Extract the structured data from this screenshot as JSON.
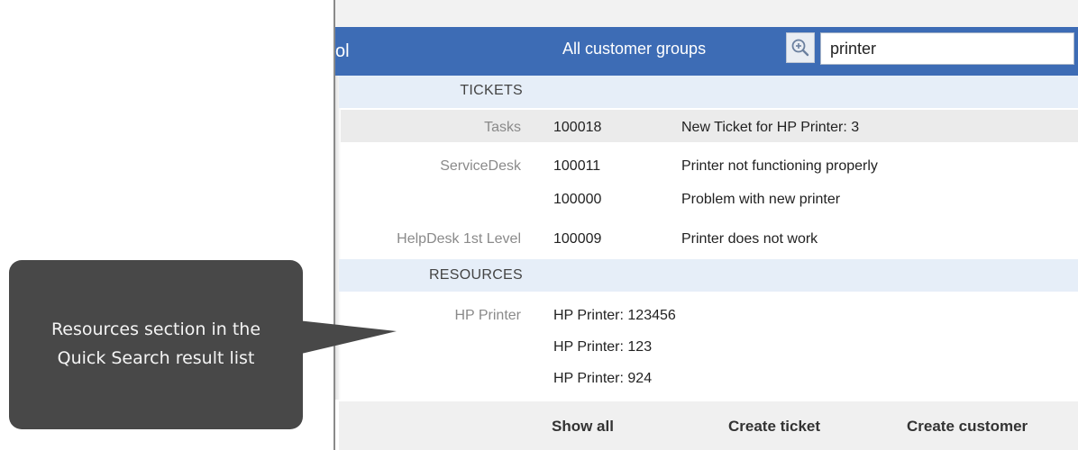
{
  "header": {
    "cut_label": "ol",
    "groups_label": "All customer groups",
    "search_value": "printer",
    "search_icon": "zoom-in-icon"
  },
  "sections": {
    "tickets_label": "TICKETS",
    "resources_label": "RESOURCES"
  },
  "tickets": [
    {
      "category": "Tasks",
      "number": "100018",
      "title": "New Ticket for HP Printer: 3"
    },
    {
      "category": "ServiceDesk",
      "number": "100011",
      "title": "Printer not functioning properly"
    },
    {
      "category": "",
      "number": "100000",
      "title": "Problem with new printer"
    },
    {
      "category": "HelpDesk 1st Level",
      "number": "100009",
      "title": "Printer does not work"
    }
  ],
  "resources": {
    "category": "HP Printer",
    "items": [
      "HP Printer: 123456",
      "HP Printer: 123",
      "HP Printer: 924"
    ]
  },
  "footer": {
    "show_all": "Show all",
    "create_ticket": "Create ticket",
    "create_customer": "Create customer"
  },
  "callout": {
    "line1": "Resources section in the",
    "line2": "Quick Search result list"
  },
  "colors": {
    "header_blue": "#3d6cb5",
    "section_bg": "#e6eef8",
    "callout_bg": "#484848"
  }
}
